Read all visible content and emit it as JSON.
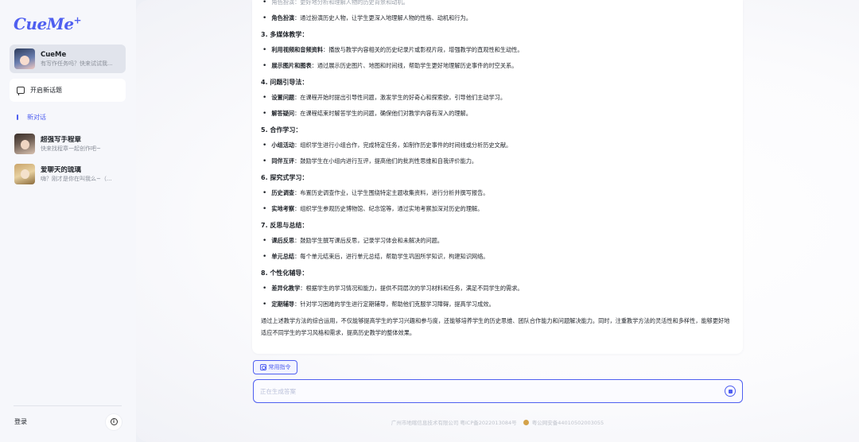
{
  "sidebar": {
    "logo": "CueMe",
    "logo_plus": "+",
    "bot": {
      "name": "CueMe",
      "subtitle": "有写作任务吗？快来试试我..."
    },
    "new_topic_label": "开启新话题",
    "new_chat_label": "新对话",
    "conversations": [
      {
        "name": "超强写手程章",
        "subtitle": "快来找程章一起创作吧~"
      },
      {
        "name": "爱聊天的琉璃",
        "subtitle": "嗨？刚才是你在叫我么~（..."
      }
    ],
    "login_label": "登录"
  },
  "message": {
    "top_partial": "角色扮演：更好地分析和理解人物的历史背景和动机。",
    "lines": [
      {
        "type": "bullet",
        "bold": "角色扮演",
        "text": "：通过扮演历史人物，让学生更深入地理解人物的性格、动机和行为。"
      },
      {
        "type": "heading",
        "text": "3. 多媒体教学："
      },
      {
        "type": "bullet",
        "bold": "利用视频和音频资料",
        "text": "：播放与教学内容相关的历史纪录片或影视片段，增强教学的直观性和生动性。"
      },
      {
        "type": "bullet",
        "bold": "展示图片和图表",
        "text": "：通过展示历史图片、地图和时间线，帮助学生更好地理解历史事件的时空关系。"
      },
      {
        "type": "heading",
        "text": "4. 问题引导法："
      },
      {
        "type": "bullet",
        "bold": "设置问题",
        "text": "：在课程开始时提出引导性问题，激发学生的好奇心和探索欲，引导他们主动学习。"
      },
      {
        "type": "bullet",
        "bold": "解答疑问",
        "text": "：在课程结束时解答学生的问题，确保他们对教学内容有深入的理解。"
      },
      {
        "type": "heading",
        "text": "5. 合作学习："
      },
      {
        "type": "bullet",
        "bold": "小组活动",
        "text": "：组织学生进行小组合作，完成特定任务，如制作历史事件的时间线或分析历史文献。"
      },
      {
        "type": "bullet",
        "bold": "同伴互评",
        "text": "：鼓励学生在小组内进行互评，提高他们的批判性思维和自我评价能力。"
      },
      {
        "type": "heading",
        "text": "6. 探究式学习："
      },
      {
        "type": "bullet",
        "bold": "历史调查",
        "text": "：布置历史调查作业，让学生围绕特定主题收集资料，进行分析并撰写报告。"
      },
      {
        "type": "bullet",
        "bold": "实地考察",
        "text": "：组织学生参观历史博物馆、纪念馆等，通过实地考察加深对历史的理解。"
      },
      {
        "type": "heading",
        "text": "7. 反思与总结："
      },
      {
        "type": "bullet",
        "bold": "课后反思",
        "text": "：鼓励学生撰写课后反思，记录学习体会和未解决的问题。"
      },
      {
        "type": "bullet",
        "bold": "单元总结",
        "text": "：每个单元结束后，进行单元总结，帮助学生巩固所学知识，构建知识网络。"
      },
      {
        "type": "heading",
        "text": "8. 个性化辅导："
      },
      {
        "type": "bullet",
        "bold": "差异化教学",
        "text": "：根据学生的学习情况和能力，提供不同层次的学习材料和任务，满足不同学生的需求。"
      },
      {
        "type": "bullet",
        "bold": "定期辅导",
        "text": "：针对学习困难的学生进行定期辅导，帮助他们克服学习障碍，提高学习成效。"
      }
    ],
    "summary": "通过上述教学方法的综合运用，不仅能够提高学生的学习兴趣和参与度，还能够培养学生的历史思维、团队合作能力和问题解决能力。同时，注重教学方法的灵活性和多样性，能够更好地适应不同学生的学习风格和需求，提高历史教学的整体效果。"
  },
  "command_button_label": "常用指令",
  "input": {
    "placeholder": "正在生成答案"
  },
  "footer": {
    "company": "广州市地喀信息技术有限公司 粤ICP备2022013084号",
    "police": "粤公网安备44010502003055"
  },
  "colors": {
    "accent": "#4f5ff0",
    "sidebar_bg": "#f6f7fb"
  }
}
